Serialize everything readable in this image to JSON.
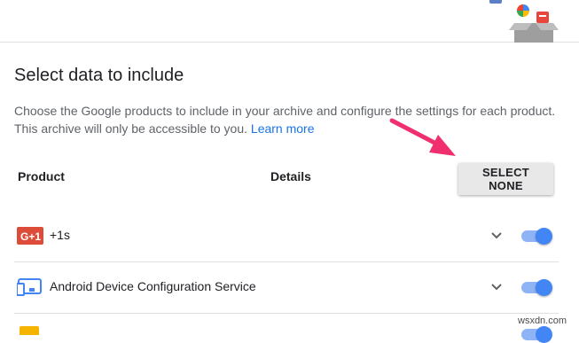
{
  "section": {
    "heading": "Select data to include",
    "description": "Choose the Google products to include in your archive and configure the settings for each product. This archive will only be accessible to you.",
    "learn_more": "Learn more"
  },
  "table": {
    "product_header": "Product",
    "details_header": "Details",
    "select_none_label": "SELECT NONE"
  },
  "products": [
    {
      "name": "+1s",
      "icon": "google-plus-one-icon",
      "included": true
    },
    {
      "name": "Android Device Configuration Service",
      "icon": "android-devices-icon",
      "included": true
    }
  ],
  "colors": {
    "accent": "#4285f4",
    "link": "#1a73e8",
    "arrow": "#f0306e",
    "google_plus_red": "#dd4b39"
  },
  "watermark": "wsxdn.com"
}
